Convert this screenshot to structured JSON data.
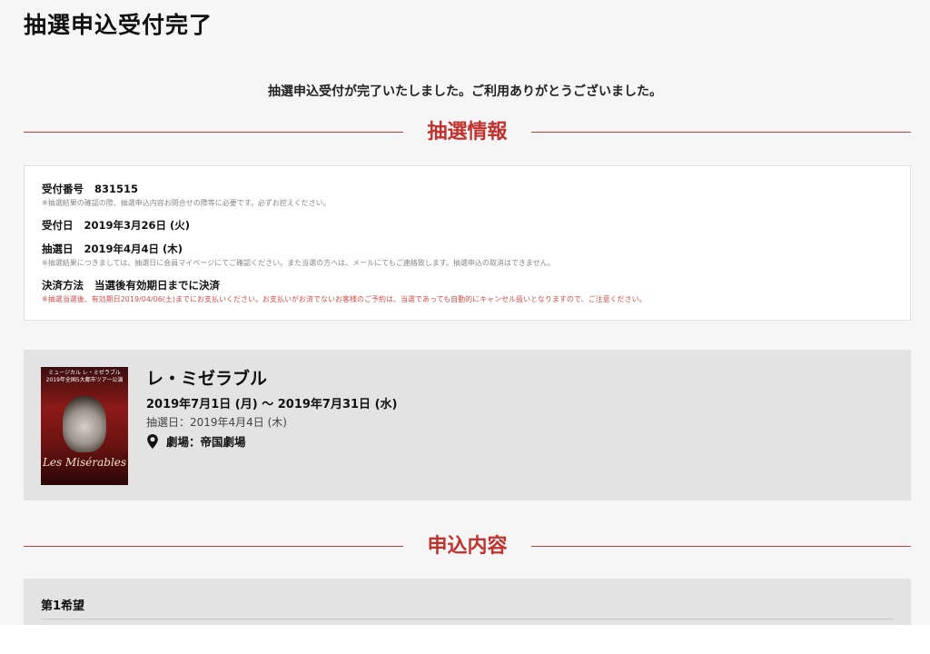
{
  "page": {
    "title": "抽選申込受付完了",
    "thanks_message": "抽選申込受付が完了いたしました。ご利用ありがとうございました。"
  },
  "lottery_info": {
    "heading": "抽選情報",
    "receipt_label": "受付番号",
    "receipt_number": "831515",
    "receipt_note": "※抽選結果の確認の際、抽選申込内容お問合せの際等に必要です。必ずお控えください。",
    "accept_date_label": "受付日",
    "accept_date": "2019年3月26日 (火)",
    "draw_date_label": "抽選日",
    "draw_date": "2019年4月4日 (木)",
    "draw_note": "※抽選結果につきましては、抽選日に会員マイページにてご確認ください。また当選の方へは、メールにてもご連絡致します。抽選申込の取消はできません。",
    "payment_label": "決済方法",
    "payment_method": "当選後有効期日までに決済",
    "payment_note": "※抽選当選後、有効期日2019/04/06(土)までにお支払いください。お支払いがお済でないお客様のご予約は、当選であっても自動的にキャンセル扱いとなりますので、ご注意ください。"
  },
  "event": {
    "name": "レ・ミゼラブル",
    "dates": "2019年7月1日 (月) ～ 2019年7月31日 (水)",
    "draw_date": "抽選日：2019年4月4日 (木)",
    "venue": "劇場：帝国劇場",
    "poster_top_text": "ミュージカル レ・ミゼラブル",
    "poster_sub_text": "2019年全国5大都市ツアー公演",
    "poster_title": "Les Misérables",
    "venue_icon": "map-pin-icon"
  },
  "application": {
    "heading": "申込内容",
    "first_choice": "第1希望"
  },
  "colors": {
    "accent": "#c1322f",
    "note_red": "#d0504e",
    "card_bg": "#e3e3e3"
  }
}
